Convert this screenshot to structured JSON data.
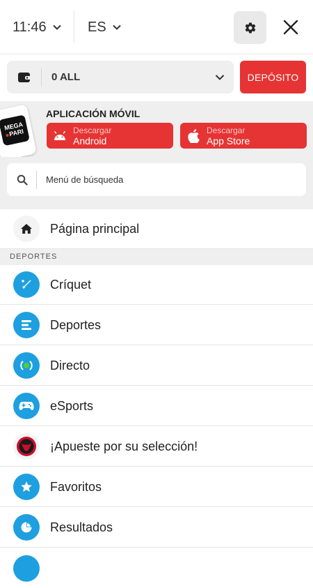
{
  "topbar": {
    "time": "11:46",
    "language": "ES",
    "settings_icon": "gear-icon",
    "close_icon": "close-icon"
  },
  "balance": {
    "value": "0 ALL",
    "deposit_label": "DEPÓSITO",
    "wallet_icon": "wallet-icon"
  },
  "app_banner": {
    "title": "APLICACIÓN MÓVIL",
    "logo_text_1": "MEGA",
    "logo_text_2": "PARI",
    "android": {
      "small": "Descargar",
      "big": "Android",
      "icon": "android-icon"
    },
    "apple": {
      "small": "Descargar",
      "big": "App Store",
      "icon": "apple-icon"
    }
  },
  "search": {
    "placeholder": "Menú de búsqueda",
    "icon": "search-icon"
  },
  "home": {
    "label": "Página principal",
    "icon": "home-icon"
  },
  "section": {
    "sports_label": "DEPORTES"
  },
  "menu": {
    "items": [
      {
        "label": "Críquet",
        "icon": "cricket-bat-icon"
      },
      {
        "label": "Deportes",
        "icon": "list-icon"
      },
      {
        "label": "Directo",
        "icon": "live-broadcast-icon"
      },
      {
        "label": "eSports",
        "icon": "gamepad-icon"
      },
      {
        "label": "¡Apueste por su selección!",
        "icon": "bull-badge-icon"
      },
      {
        "label": "Favoritos",
        "icon": "star-icon"
      },
      {
        "label": "Resultados",
        "icon": "pie-chart-icon"
      }
    ]
  },
  "colors": {
    "accent_red": "#e53433",
    "icon_blue": "#1e9fe0",
    "panel_grey": "#efefef"
  }
}
